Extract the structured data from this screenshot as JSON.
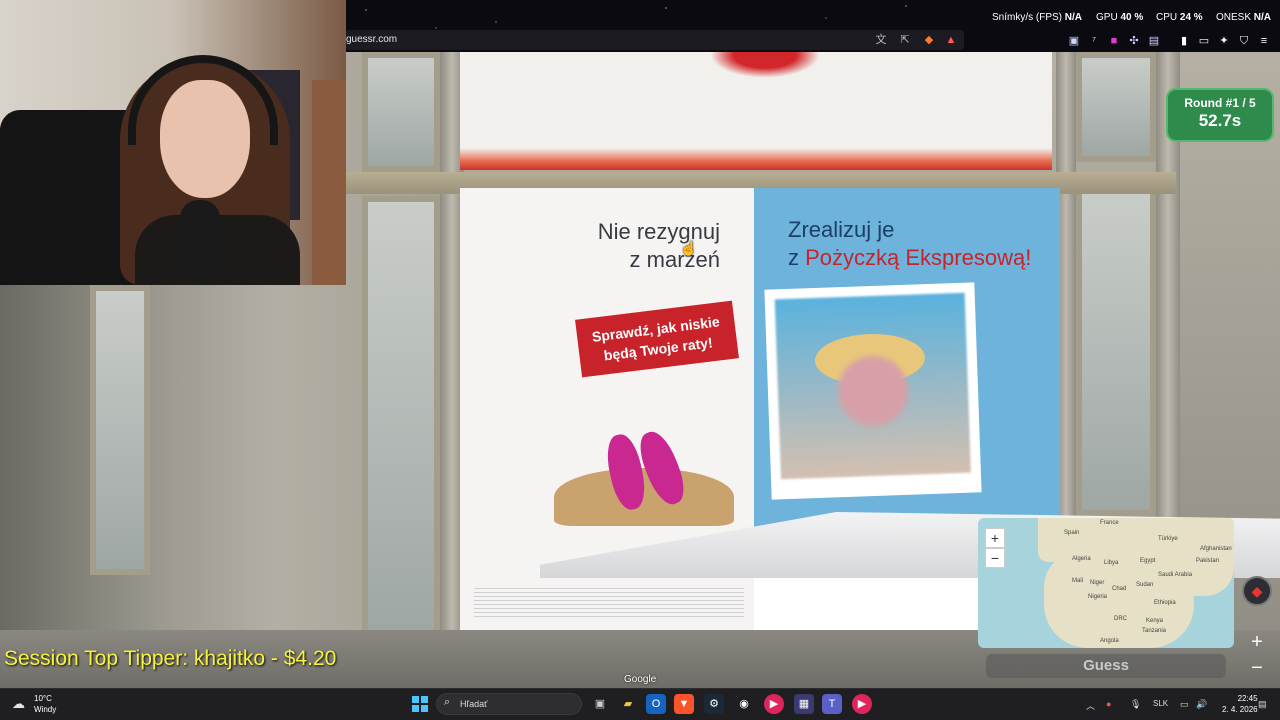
{
  "browser": {
    "url": "guessr.com",
    "perf": {
      "fps_label": "Snímky/s (FPS)",
      "fps_value": "N/A",
      "gpu_label": "GPU",
      "gpu_value": "40 %",
      "cpu_label": "CPU",
      "cpu_value": "24 %",
      "onesk_label": "ONESK",
      "onesk_value": "N/A"
    }
  },
  "game": {
    "round_label": "Round #1 / 5",
    "timer": "52.7s",
    "guess_label": "Guess",
    "zoom_in": "+",
    "zoom_out": "−",
    "map_labels": {
      "france": "France",
      "spain": "Spain",
      "turkiye": "Türkiye",
      "afghanistan": "Afghanistan",
      "algeria": "Algeria",
      "libya": "Libya",
      "egypt": "Egypt",
      "pakistan": "Pakistan",
      "mali": "Mali",
      "niger": "Niger",
      "chad": "Chad",
      "sudan": "Sudan",
      "saudi_arabia": "Saudi Arabia",
      "nigeria": "Nigeria",
      "ethiopia": "Ethiopia",
      "drc": "DRC",
      "kenya": "Kenya",
      "tanzania": "Tanzania",
      "angola": "Angola"
    }
  },
  "streetview": {
    "poster_left_line1": "Nie rezygnuj",
    "poster_left_line2": "z marzeń",
    "poster_right_line1": "Zrealizuj je",
    "poster_right_line2_prefix": "z ",
    "poster_right_line2_highlight": "Pożyczką Ekspresową!",
    "cta_line1": "Sprawdź, jak niskie",
    "cta_line2": "będą Twoje raty!",
    "google": "Google"
  },
  "overlay": {
    "tipper": "Session Top Tipper: khajitko - $4.20"
  },
  "taskbar": {
    "temp": "10°C",
    "weather": "Windy",
    "search_placeholder": "Hľadať",
    "lang": "SLK",
    "time": "22:45",
    "date": "2. 4. 2026"
  },
  "colors": {
    "round_panel": "#2e8b4c",
    "tipper_text": "#f7f33a",
    "poster_red": "#c8232b",
    "poster_blue": "#6db3dc"
  }
}
